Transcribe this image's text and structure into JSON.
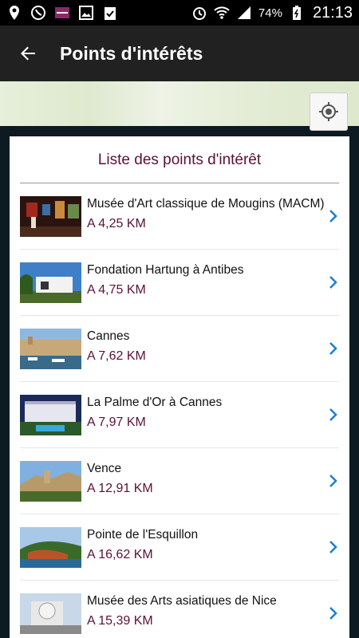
{
  "status_bar": {
    "battery": "74%",
    "time": "21:13"
  },
  "app_bar": {
    "title": "Points d'intérêts"
  },
  "list": {
    "title": "Liste des points d'intérêt",
    "items": [
      {
        "name": "Musée d'Art classique de Mougins (MACM)",
        "distance": "A 4,25 KM"
      },
      {
        "name": "Fondation Hartung à Antibes",
        "distance": "A 4,75 KM"
      },
      {
        "name": "Cannes",
        "distance": "A 7,62 KM"
      },
      {
        "name": "La Palme d'Or à Cannes",
        "distance": "A 7,97 KM"
      },
      {
        "name": "Vence",
        "distance": "A 12,91 KM"
      },
      {
        "name": "Pointe de l'Esquillon",
        "distance": "A 16,62 KM"
      },
      {
        "name": "Musée des Arts asiatiques de Nice",
        "distance": "A 15,39 KM"
      }
    ]
  },
  "colors": {
    "accent": "#5a1136",
    "chevron": "#1a7fd4",
    "app_bar": "#212121"
  }
}
